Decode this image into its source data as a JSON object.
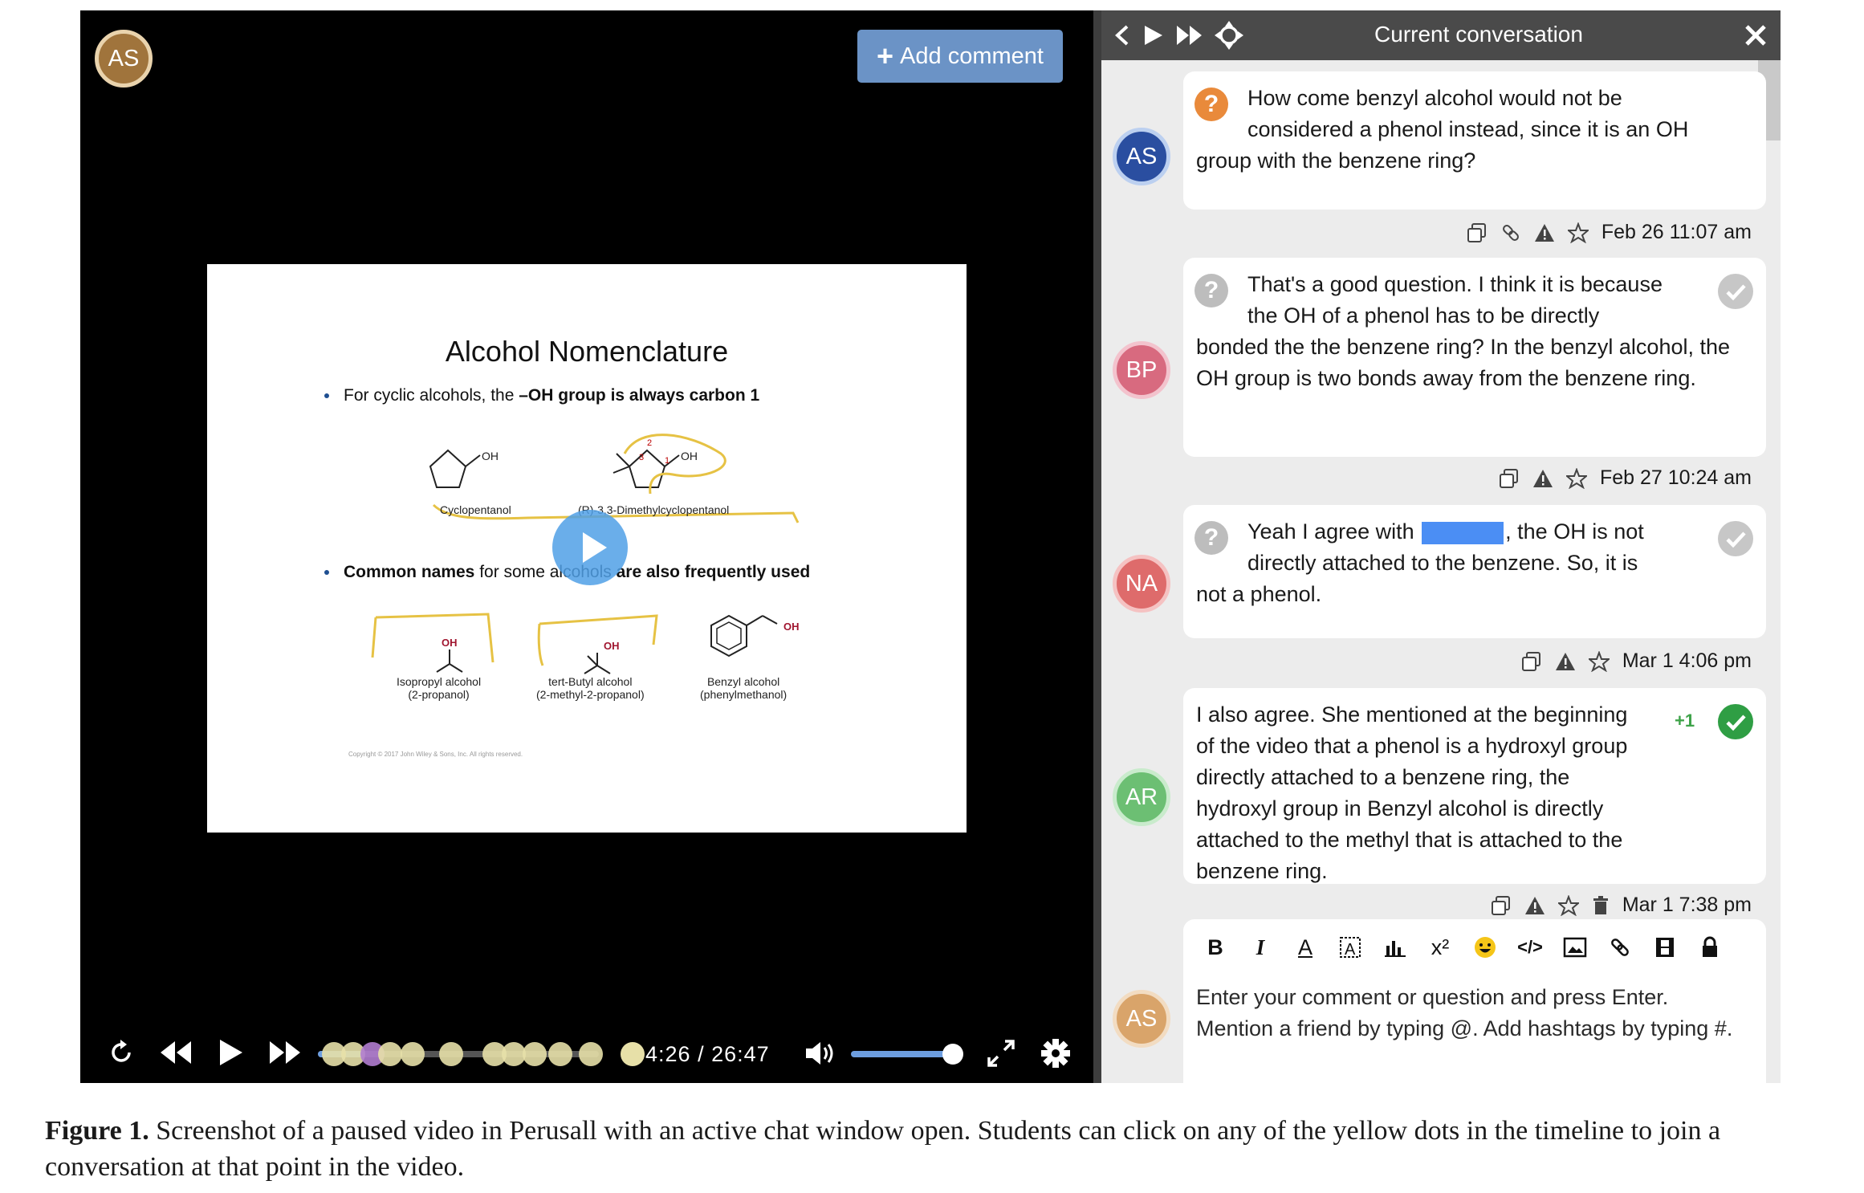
{
  "video": {
    "overlay_avatar": "AS",
    "add_comment_label": "Add comment",
    "slide": {
      "title": "Alcohol Nomenclature",
      "bullet1_a": "For cyclic alcohols, the ",
      "bullet1_b": "–OH group is always carbon 1",
      "bullet2_a": "Common names ",
      "bullet2_b": "for some alcohols",
      "bullet2_c": " are also frequently used",
      "label_oh": "OH",
      "label_1": "1",
      "label_2": "2",
      "label_3": "3",
      "cyclopentanol": "Cyclopentanol",
      "dimethyl": "(R)-3,3-Dimethylcyclopentanol",
      "isopropyl": "Isopropyl alcohol",
      "isopropyl_sub": "(2-propanol)",
      "tertbutyl": "tert-Butyl alcohol",
      "tertbutyl_sub": "(2-methyl-2-propanol)",
      "benzyl": "Benzyl alcohol",
      "benzyl_sub": "(phenylmethanol)",
      "copyright": "Copyright © 2017 John Wiley & Sons, Inc. All rights reserved."
    },
    "controls": {
      "time_current": "04:26",
      "time_sep": "/",
      "time_total": "26:47",
      "progress_fraction": 0.166,
      "volume_fraction": 1.0
    },
    "colors": {
      "timeline_dot": "#e7e0a8",
      "timeline_dot_active": "#b07ccf",
      "volume": "#6d9ee0"
    }
  },
  "panel": {
    "title": "Current conversation",
    "messages": [
      {
        "avatar": "AS",
        "avatar_color": "#2a4ea0",
        "badge": "?",
        "badge_color": "#e98a3b",
        "text_first": "How come benzyl alcohol would not be",
        "text_second": "considered a phenol instead, since it is an OH",
        "text_rest": "group with the benzene ring?",
        "date": "Feb 26 11:07 am"
      },
      {
        "avatar": "BP",
        "avatar_color": "#d86a7f",
        "badge": "?",
        "badge_color": "#bdbdbd",
        "text_first": "That's a good question. I think it is because",
        "text_second": "the OH of a phenol has to be directly",
        "text_rest": "bonded the the benzene ring? In the benzyl alcohol, the OH group is two bonds away from the benzene ring.",
        "date": "Feb 27 10:24 am"
      },
      {
        "avatar": "NA",
        "avatar_color": "#de6b6b",
        "badge": "?",
        "badge_color": "#bdbdbd",
        "text_first_a": "Yeah I agree with ",
        "text_first_b": ", the OH is not",
        "text_second": "directly attached to the benzene. So, it is",
        "text_rest": "not a phenol.",
        "date": "Mar 1 4:06 pm"
      },
      {
        "avatar": "AR",
        "avatar_color": "#6cbf73",
        "plus_one": "+1",
        "text": "I also agree. She mentioned at the beginning of the video that a phenol is a hydroxyl group directly attached to a benzene ring, the hydroxyl group in Benzyl alcohol is directly attached to the methyl that is attached to the benzene ring.",
        "date": "Mar 1 7:38 pm"
      }
    ],
    "editor": {
      "avatar": "AS",
      "avatar_color": "#d9a46a",
      "placeholder": "Enter your comment or question and press Enter. Mention a friend by typing @. Add hashtags by typing #.",
      "toolbar": {
        "bold": "B",
        "italic": "I",
        "font_color": "A",
        "superscript": "x²",
        "code": "</>"
      }
    }
  },
  "caption": {
    "label": "Figure 1.",
    "text": " Screenshot of a paused video in Perusall with an active chat window open. Students can click on any of the yellow dots in the timeline to join a conversation at that point in the video."
  }
}
